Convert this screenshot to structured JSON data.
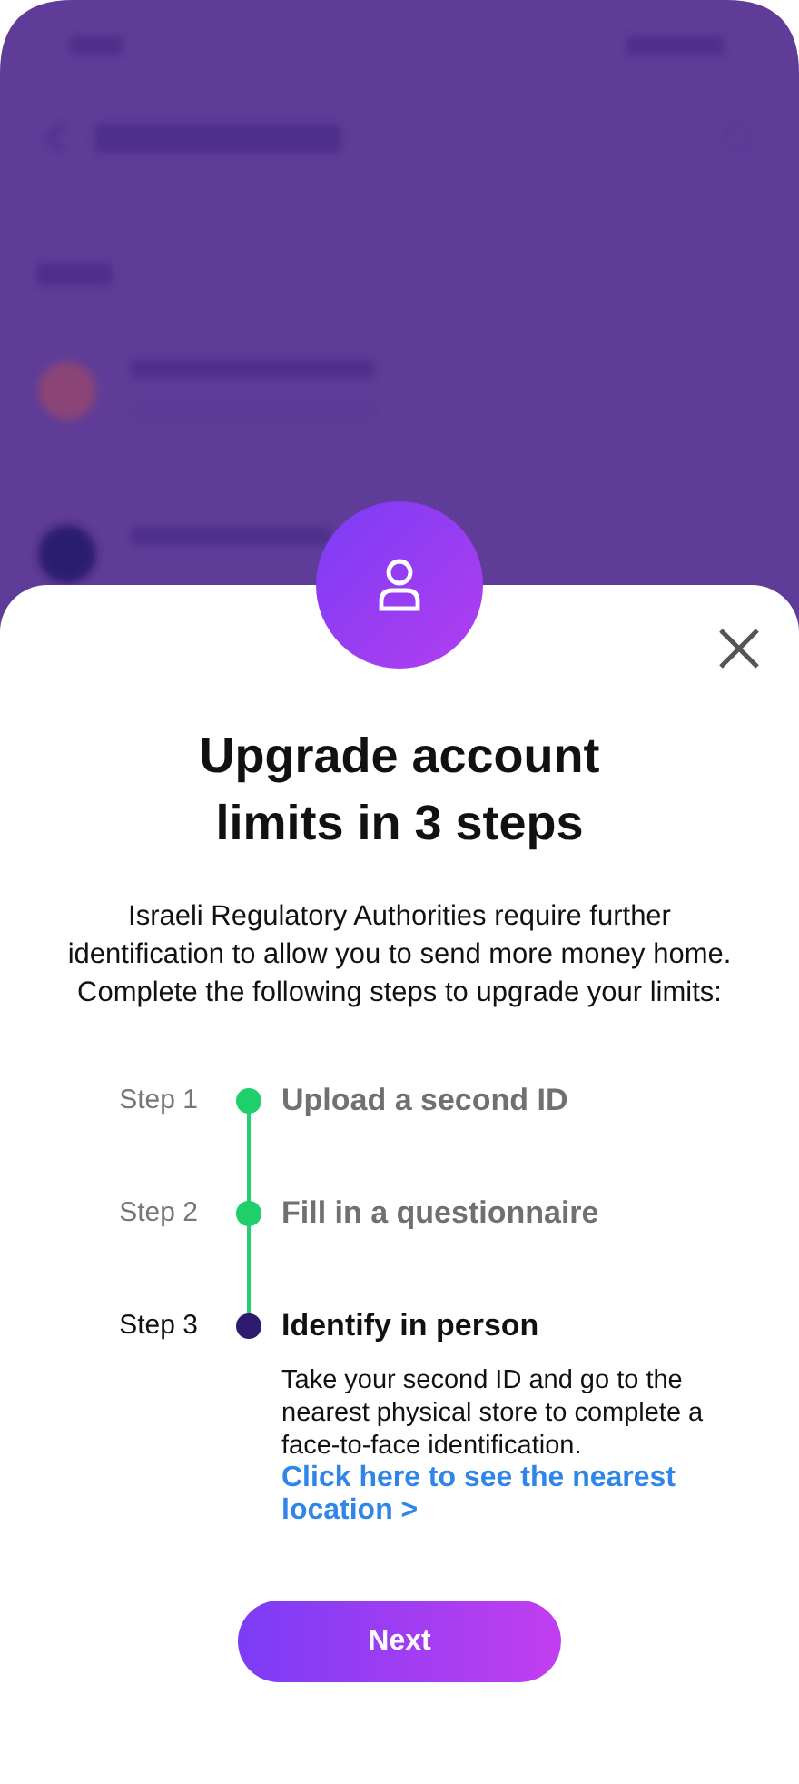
{
  "sheet": {
    "title": "Upgrade account limits in 3 steps",
    "description": "Israeli Regulatory Authorities require further identification to allow you to send more money home. Complete the following steps to upgrade your limits:",
    "steps": [
      {
        "label": "Step 1",
        "title": "Upload a second ID",
        "completed": true
      },
      {
        "label": "Step 2",
        "title": "Fill in a questionnaire",
        "completed": true
      },
      {
        "label": "Step 3",
        "title": "Identify in person",
        "completed": false,
        "detail": "Take your second ID and go to the nearest physical store to complete a face-to-face identification.",
        "link": "Click here to see the nearest location >"
      }
    ],
    "button": "Next"
  }
}
